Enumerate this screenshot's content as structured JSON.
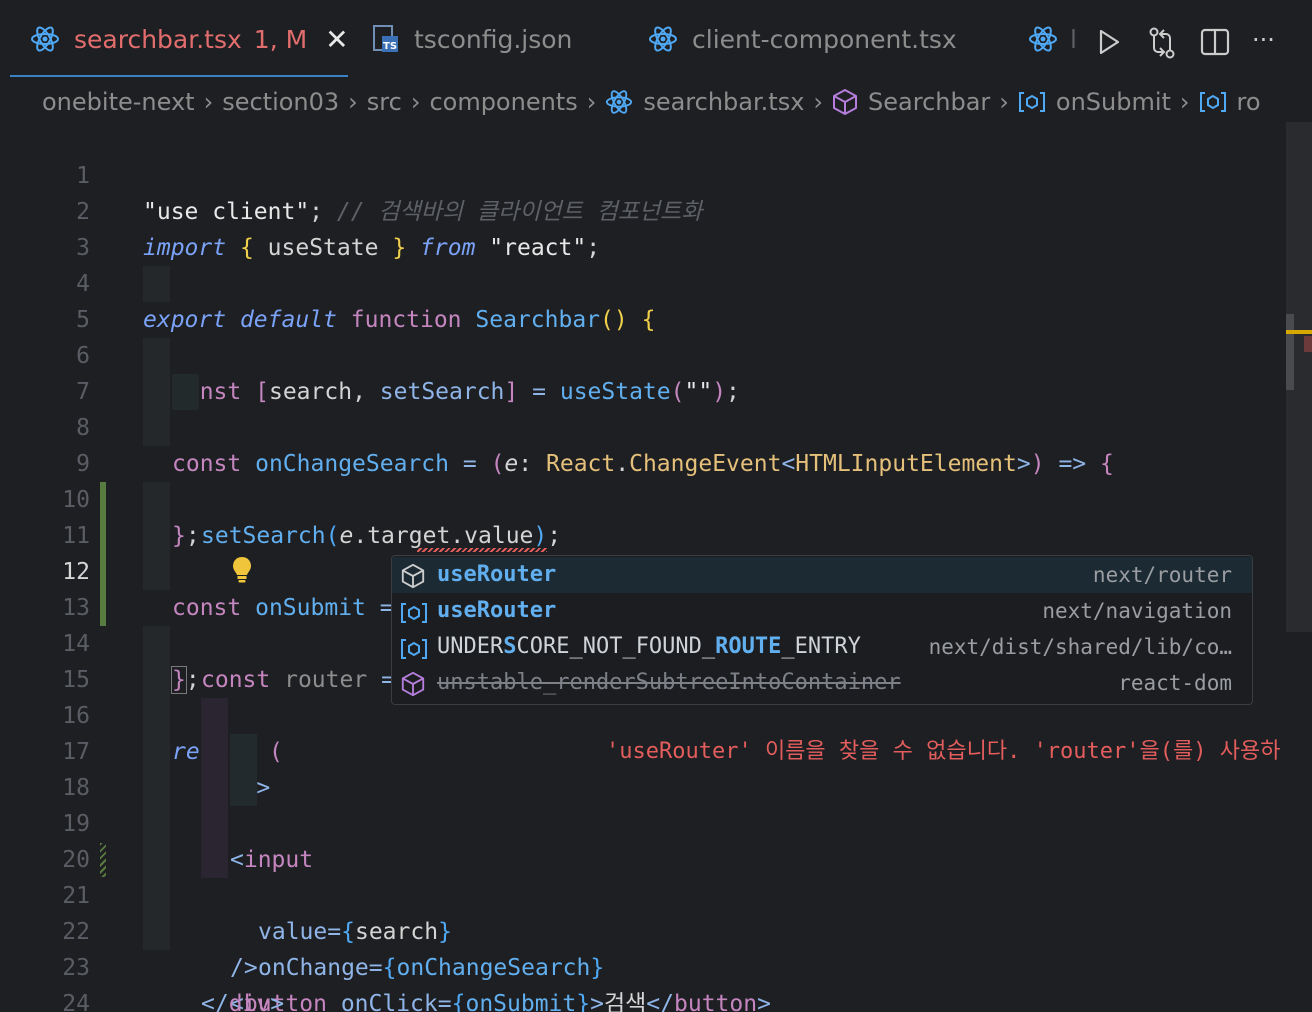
{
  "tabs": [
    {
      "label": "searchbar.tsx",
      "badge": "1, M",
      "active": true,
      "icon": "react-icon",
      "close": "✕"
    },
    {
      "label": "tsconfig.json",
      "active": false,
      "icon": "ts-file-icon"
    },
    {
      "label": "client-component.tsx",
      "active": false,
      "icon": "react-icon"
    },
    {
      "label": "l",
      "active": false,
      "icon": "react-icon"
    }
  ],
  "tab_actions": [
    "run-icon",
    "compare-changes-icon",
    "split-editor-icon",
    "more-actions-icon"
  ],
  "more_glyph": "···",
  "breadcrumb": {
    "items": [
      "onebite-next",
      "section03",
      "src",
      "components",
      "searchbar.tsx",
      "Searchbar",
      "onSubmit",
      "ro"
    ],
    "sep": "›"
  },
  "line_numbers": [
    "1",
    "2",
    "3",
    "4",
    "5",
    "6",
    "7",
    "8",
    "9",
    "10",
    "11",
    "12",
    "13",
    "14",
    "15",
    "16",
    "17",
    "18",
    "19",
    "20",
    "21",
    "22",
    "23",
    "24"
  ],
  "code": {
    "l1": {
      "str": "\"use client\"",
      "semi": ";",
      "comment": "// 검색바의 클라이언트 컴포넌트화"
    },
    "l2": {
      "import": "import",
      "ob": "{",
      "name": "useState",
      "cb": "}",
      "from": "from",
      "str": "\"react\"",
      "semi": ";"
    },
    "l4": {
      "export": "export",
      "default": "default",
      "function": "function",
      "name": "Searchbar",
      "parens": "()",
      "ob": "{"
    },
    "l5": {
      "const": "const",
      "ob": "[",
      "a": "search",
      "comma": ",",
      "b": "setSearch",
      "cb": "]",
      "eq": "=",
      "fn": "useState",
      "op": "(",
      "str": "\"\"",
      "cp": ")",
      "semi": ";"
    },
    "l7": {
      "const": "const",
      "name": "onChangeSearch",
      "eq": "=",
      "op": "(",
      "param": "e",
      "colon": ":",
      "type1": "React",
      "dot": ".",
      "type2": "ChangeEvent",
      "lt": "<",
      "type3": "HTMLInputElement",
      "gt": ">",
      "cp": ")",
      "arrow": "=>",
      "ob": "{"
    },
    "l8": {
      "fn": "setSearch",
      "op": "(",
      "param": "e",
      "d1": ".",
      "p1": "target",
      "d2": ".",
      "p2": "value",
      "cp": ")",
      "semi": ";"
    },
    "l9": {
      "cb": "}",
      "semi": ";"
    },
    "l11": {
      "const": "const",
      "name": "onSubmit",
      "eq": "=",
      "parens": "()",
      "arrow": "=>",
      "ob": "{"
    },
    "l12": {
      "const": "const",
      "name": "router",
      "eq": "=",
      "fn": "useRouter",
      "error": "'useRouter' 이름을 찾을 수 없습니다. 'router'을(를) 사용하"
    },
    "l13": {
      "cb": "}",
      "semi": ";"
    },
    "l15": {
      "return": "return",
      "op": "("
    },
    "l16": {
      "open": "<",
      "tag": "div",
      "close": ">"
    },
    "l17": {
      "open": "<",
      "tag": "input"
    },
    "l18": {
      "attr": "value",
      "eq": "=",
      "ob": "{",
      "val": "search",
      "cb": "}"
    },
    "l19": {
      "attr": "onChange",
      "eq": "=",
      "ob": "{",
      "val": "onChangeSearch",
      "cb": "}"
    },
    "l20": {
      "selfclose": "/>"
    },
    "l21": {
      "open": "<",
      "tag": "button",
      "attr": "onClick",
      "eq": "=",
      "ob": "{",
      "val": "onSubmit",
      "cb": "}",
      "gt": ">",
      "text": "검색",
      "close_open": "</",
      "ctag": "button",
      "close": ">"
    },
    "l22": {
      "open": "</",
      "tag": "div",
      "close": ">"
    },
    "l23": {
      "cp": ")",
      "semi": ";"
    },
    "l24": {
      "cb": "}"
    }
  },
  "suggestions": [
    {
      "label_bold": "useRouter",
      "label_rest": "",
      "detail": "next/router",
      "icon": "module-icon",
      "selected": true
    },
    {
      "label_bold": "useRouter",
      "label_rest": "",
      "detail": "next/navigation",
      "icon": "variable-icon",
      "selected": false
    },
    {
      "label_pre": "UNDER",
      "label_b1": "S",
      "label_mid1": "CORE_NOT_FOUND_",
      "label_b2": "ROUTE",
      "label_mid2": "_ENTRY",
      "detail": "next/dist/shared/lib/co…",
      "icon": "variable-icon",
      "selected": false
    },
    {
      "label_full": "unstable_renderSubtreeIntoContainer",
      "detail": "react-dom",
      "icon": "module-icon",
      "deprecated": true,
      "selected": false
    }
  ],
  "colors": {
    "background": "#1e1f22",
    "error": "#e35d5d",
    "keyword": "#c586c0",
    "function": "#61afef",
    "active_tab": "#e26d6d"
  }
}
